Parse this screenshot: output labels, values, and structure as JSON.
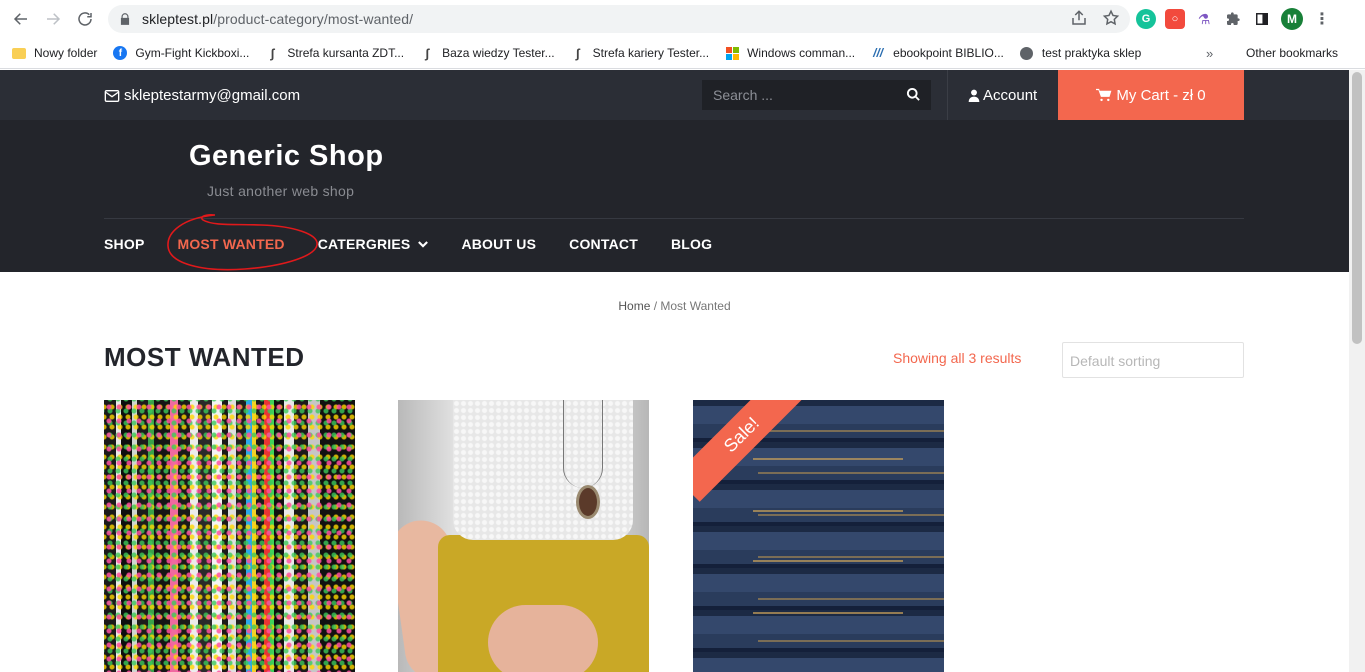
{
  "browser": {
    "url_domain": "skleptest.pl",
    "url_path": "/product-category/most-wanted/",
    "bookmarks": [
      {
        "label": "Nowy folder",
        "icon": "folder-icon"
      },
      {
        "label": "Gym-Fight Kickboxi...",
        "icon": "facebook-icon"
      },
      {
        "label": "Strefa kursanta ZDT...",
        "icon": "s-logo-icon"
      },
      {
        "label": "Baza wiedzy Tester...",
        "icon": "s-logo-icon"
      },
      {
        "label": "Strefa kariery Tester...",
        "icon": "s-logo-icon"
      },
      {
        "label": "Windows comman...",
        "icon": "windows-icon"
      },
      {
        "label": "ebookpoint BIBLIO...",
        "icon": "ebookpoint-icon"
      },
      {
        "label": "test praktyka sklep",
        "icon": "globe-icon"
      }
    ],
    "bookmarks_overflow": "»",
    "other_bookmarks": "Other bookmarks",
    "profile_initial": "M"
  },
  "topbar": {
    "email": "skleptestarmy@gmail.com",
    "search_placeholder": "Search ...",
    "account": "Account",
    "cart": "My Cart - zł 0"
  },
  "header": {
    "site_title": "Generic Shop",
    "tagline": "Just another web shop"
  },
  "menu": {
    "items": [
      {
        "label": "SHOP"
      },
      {
        "label": "MOST WANTED"
      },
      {
        "label": "CATERGRIES"
      },
      {
        "label": "ABOUT US"
      },
      {
        "label": "CONTACT"
      },
      {
        "label": "BLOG"
      }
    ]
  },
  "breadcrumb": {
    "home": "Home",
    "separator": " / ",
    "current": "Most Wanted"
  },
  "category": {
    "title": "MOST WANTED",
    "results": "Showing all 3 results",
    "sorting": "Default sorting"
  },
  "products": {
    "sale_badge": "Sale!"
  },
  "colors": {
    "accent": "#f3674e",
    "topbar_bg": "#2b2e36",
    "header_bg": "#23252b",
    "annotation": "#e0191b"
  }
}
